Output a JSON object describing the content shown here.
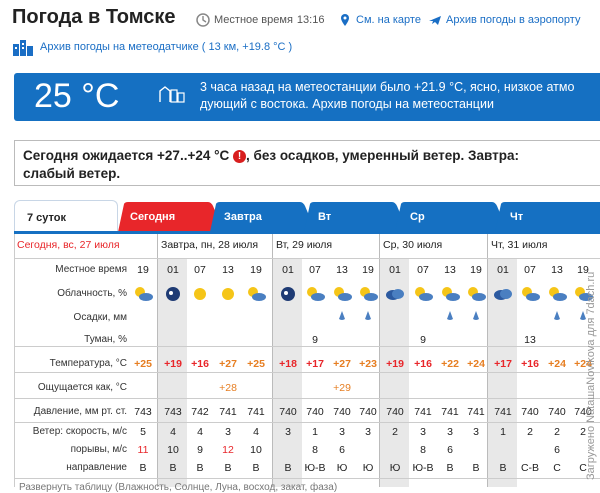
{
  "header": {
    "title": "Погода в Томске",
    "local_time_label": "Местное время",
    "local_time": "13:16",
    "map_link": "См. на карте",
    "airport_link": "Архив погоды в аэропорту",
    "station_link": "Архив погоды на метеодатчике ( 13 км, +19.8 °С )"
  },
  "current": {
    "temp": "25 °C",
    "line1": "3 часа назад на метеостанции было +21.9 °C, ясно, низкое атмо",
    "line2": "дующий с востока. Архив погоды на метеостанции"
  },
  "forecast": {
    "part1": "Сегодня ожидается +27..+24 °C",
    "warn": "!",
    "part2": ", без осадков, умеренный ветер. Завтра:",
    "line2": "слабый ветер."
  },
  "tabs": [
    "7 суток",
    "Сегодня",
    "Завтра",
    "Вт",
    "Ср",
    "Чт"
  ],
  "days": {
    "d0": "Сегодня, вс, 27 июля",
    "d1": "Завтра, пн, 28 июля",
    "d2": "Вт, 29 июля",
    "d3": "Ср, 30 июля",
    "d4": "Чт, 31 июля"
  },
  "labels": {
    "time": "Местное время",
    "cloud": "Облачность, %",
    "precip": "Осадки, мм",
    "fog": "Туман, %",
    "temp": "Температура, °C",
    "feels": "Ощущается как, °C",
    "pressure": "Давление, мм рт. ст.",
    "wind": "Ветер: скорость, м/с",
    "gusts": "порывы, м/с",
    "direction": "направление",
    "bottom_note": "Развернуть таблицу (Влажность, Солнце, Луна, восход, закат, фаза)"
  },
  "hours": [
    "19",
    "01",
    "07",
    "13",
    "19",
    "01",
    "07",
    "13",
    "19",
    "01",
    "07",
    "13",
    "19",
    "01",
    "07",
    "13",
    "19"
  ],
  "temps": [
    "+25",
    "+19",
    "+16",
    "+27",
    "+25",
    "+18",
    "+17",
    "+27",
    "+23",
    "+19",
    "+16",
    "+22",
    "+24",
    "+17",
    "+16",
    "+24",
    "+24"
  ],
  "feels": {
    "c3": "+28",
    "c7": "+29"
  },
  "pressure": [
    "743",
    "743",
    "742",
    "741",
    "741",
    "740",
    "740",
    "740",
    "740",
    "740",
    "741",
    "741",
    "741",
    "741",
    "740",
    "740",
    "740"
  ],
  "wind": [
    "5",
    "4",
    "4",
    "3",
    "4",
    "3",
    "1",
    "3",
    "3",
    "2",
    "3",
    "3",
    "3",
    "1",
    "2",
    "2",
    "2"
  ],
  "gusts": [
    "11",
    "10",
    "9",
    "12",
    "10",
    "",
    "8",
    "6",
    "",
    "",
    "8",
    "6",
    "",
    "",
    "",
    "6",
    ""
  ],
  "direction": [
    "В",
    "В",
    "В",
    "В",
    "В",
    "В",
    "Ю-В",
    "Ю",
    "Ю",
    "Ю",
    "Ю-В",
    "В",
    "В",
    "В",
    "С-В",
    "С",
    "С"
  ],
  "fog": {
    "c6": "9",
    "c10": "9",
    "c14": "13"
  },
  "watermark": "Загружено NataшaNovikova для 7dach.ru",
  "colors": {
    "accent": "#1570c2",
    "red": "#e8262a",
    "tab": "#1570c2",
    "tab_today": "#e8262a"
  }
}
